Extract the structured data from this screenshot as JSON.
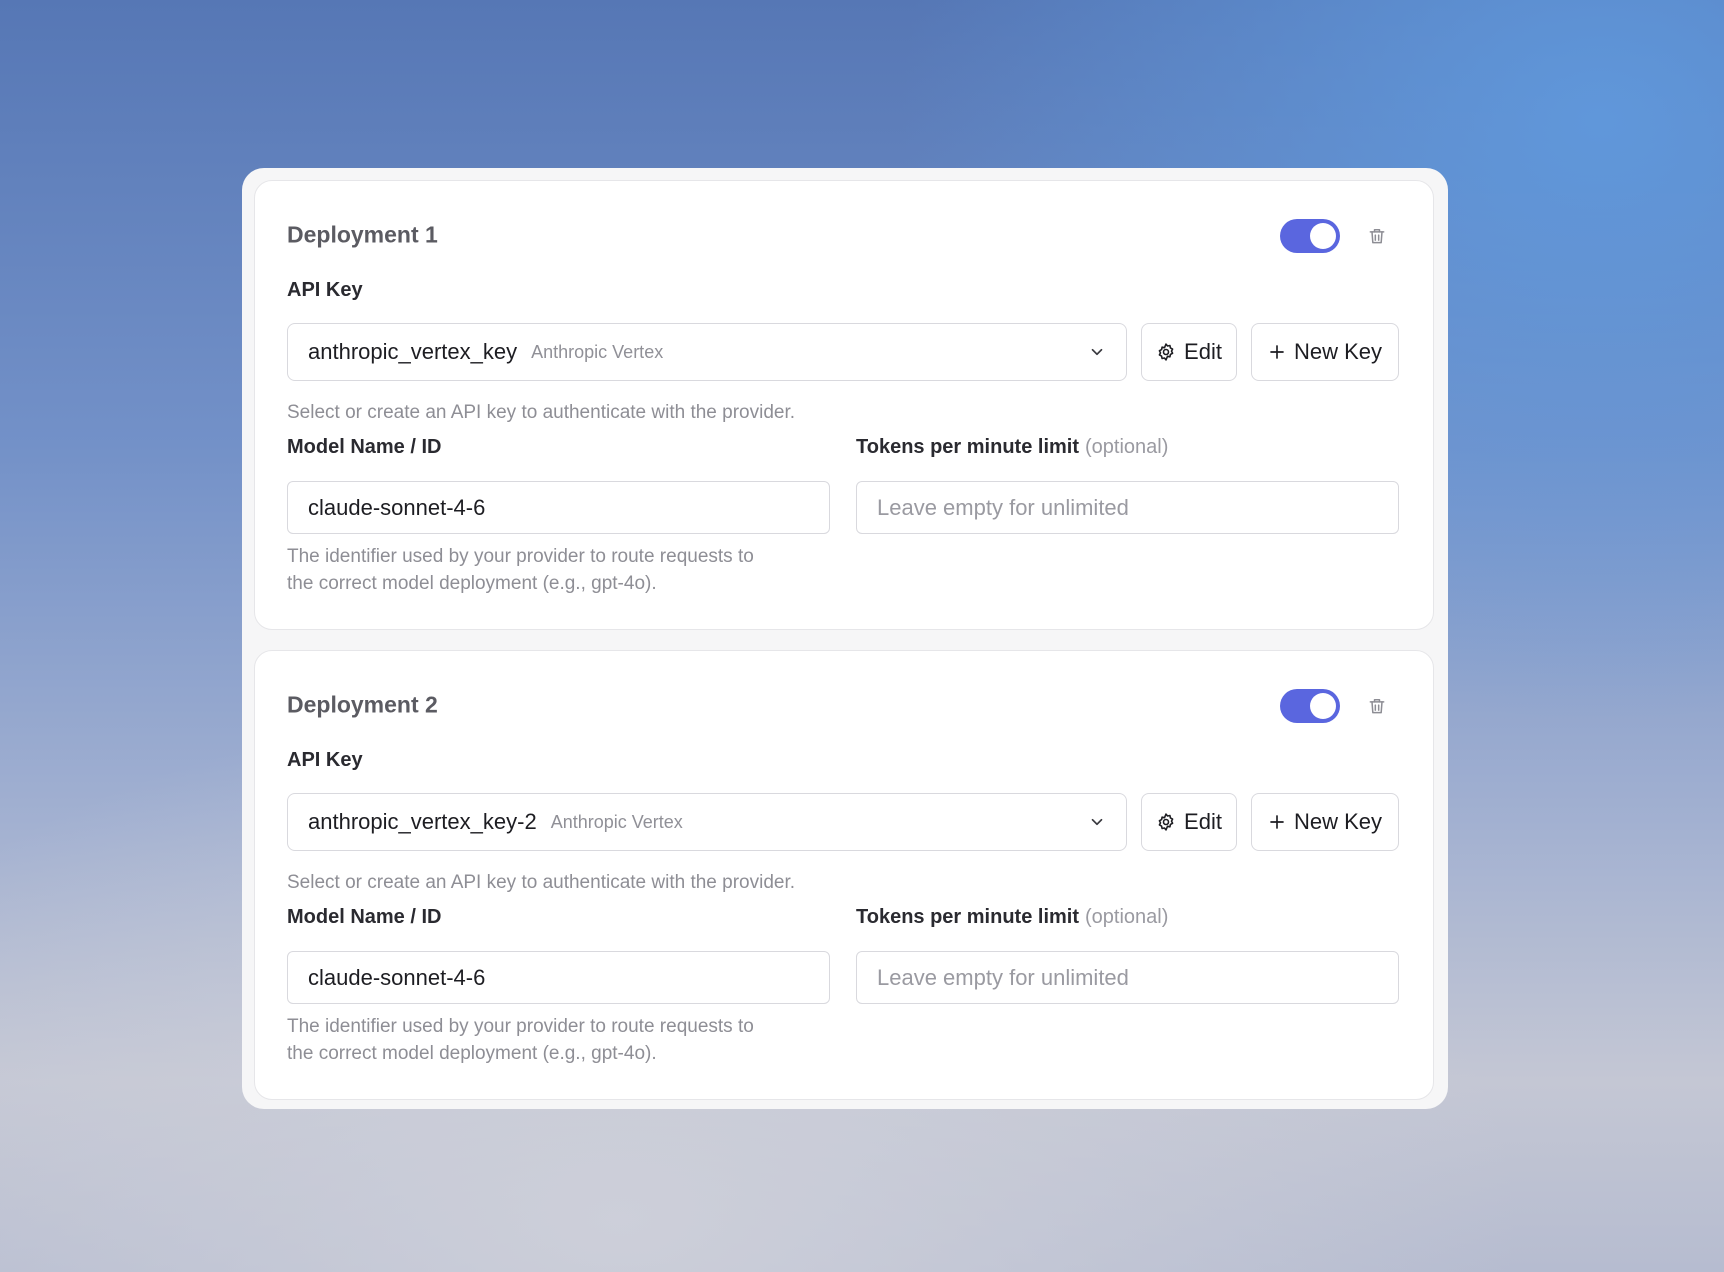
{
  "deployments": [
    {
      "title": "Deployment 1",
      "enabled": true,
      "api_key_label": "API Key",
      "api_key_value": "anthropic_vertex_key",
      "api_key_provider": "Anthropic Vertex",
      "edit_label": "Edit",
      "new_key_label": "New Key",
      "api_key_help": "Select or create an API key to authenticate with the provider.",
      "model_label": "Model Name / ID",
      "model_value": "claude-sonnet-4-6",
      "model_help_line1": "The identifier used by your provider to route requests to",
      "model_help_line2": "the correct model deployment (e.g., gpt-4o).",
      "tpm_label": "Tokens per minute limit",
      "tpm_optional": "(optional)",
      "tpm_placeholder": "Leave empty for unlimited"
    },
    {
      "title": "Deployment 2",
      "enabled": true,
      "api_key_label": "API Key",
      "api_key_value": "anthropic_vertex_key-2",
      "api_key_provider": "Anthropic Vertex",
      "edit_label": "Edit",
      "new_key_label": "New Key",
      "api_key_help": "Select or create an API key to authenticate with the provider.",
      "model_label": "Model Name / ID",
      "model_value": "claude-sonnet-4-6",
      "model_help_line1": "The identifier used by your provider to route requests to",
      "model_help_line2": "the correct model deployment (e.g., gpt-4o).",
      "tpm_label": "Tokens per minute limit",
      "tpm_optional": "(optional)",
      "tpm_placeholder": "Leave empty for unlimited"
    }
  ],
  "colors": {
    "toggle_on": "#5a66df"
  },
  "icons": {
    "delete": "trash-icon",
    "dropdown": "chevron-down-icon",
    "edit": "gear-icon",
    "new": "plus-icon"
  }
}
